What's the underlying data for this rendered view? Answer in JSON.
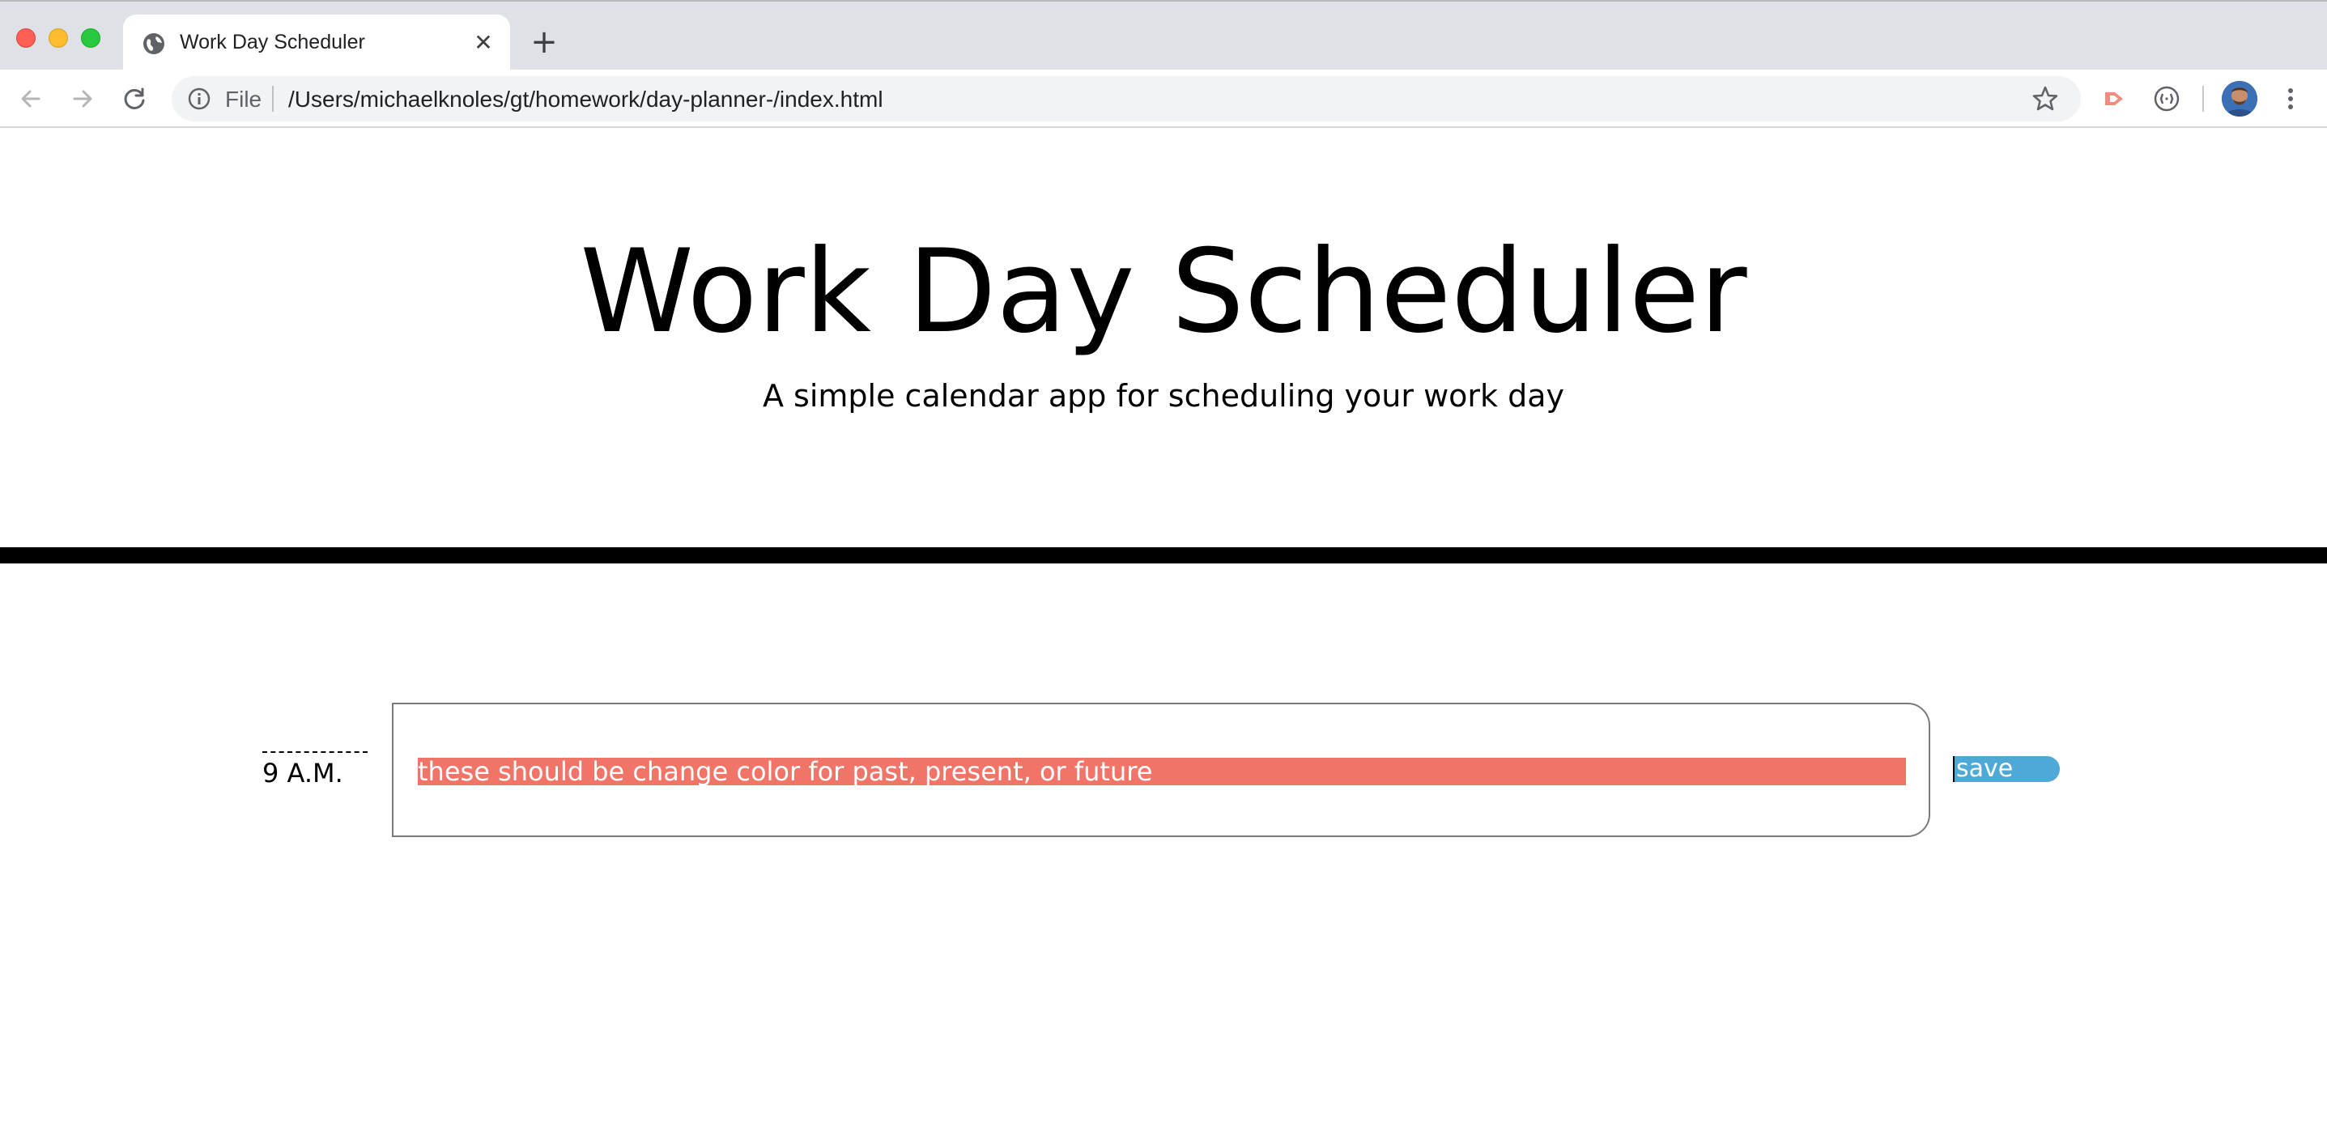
{
  "browser": {
    "tab_title": "Work Day Scheduler",
    "url_scheme_label": "File",
    "url": "/Users/michaelknoles/gt/homework/day-planner-/index.html",
    "icons": [
      "globe-icon",
      "close-icon",
      "plus-icon",
      "back-arrow-icon",
      "forward-arrow-icon",
      "reload-icon",
      "info-icon",
      "star-icon",
      "extension-icon",
      "extension-icon",
      "avatar",
      "more-vert-icon"
    ]
  },
  "header": {
    "title": "Work Day Scheduler",
    "subtitle": "A simple calendar app for scheduling your work day"
  },
  "schedule": {
    "rows": [
      {
        "hour": "9 A.M.",
        "description": "these should be change color for past, present, or future",
        "save_label": "save"
      }
    ]
  },
  "colors": {
    "past_present_future_highlight": "#f07468",
    "save_button": "#4fa9d6",
    "divider": "#000000",
    "page_background": "#ffffff"
  }
}
